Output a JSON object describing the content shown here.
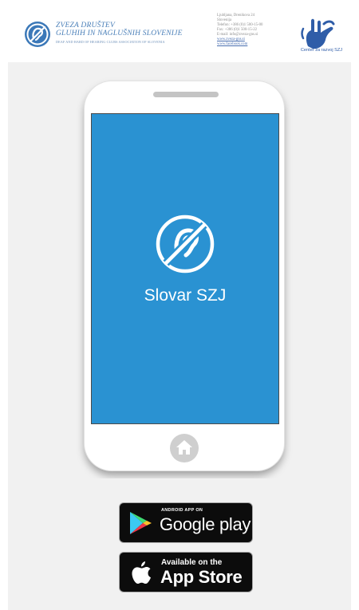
{
  "header": {
    "org": {
      "line1": "ZVEZA DRUŠTEV",
      "line2": "GLUHIH IN NAGLUŠNIH SLOVENIJE",
      "line3": "DEAF AND HARD OF HEARING CLUBS ASSOCIATION OF SLOVENIA"
    },
    "contact": {
      "address1": "Ljubljana, Drenikova 24",
      "address2": "Slovenija",
      "phone": "Telefon: +386 (0)1 500-15-00",
      "fax": "Fax: +386 (0)1 500-15-22",
      "email": "E-mail: info@zveza-gns.si",
      "web1": "www.zveza-gns.si",
      "web2": "www.facebook.com"
    },
    "center_label": "Center za razvoj SZJ"
  },
  "app": {
    "title": "Slovar SZJ"
  },
  "stores": {
    "google": {
      "small": "ANDROID APP ON",
      "large": "Google play"
    },
    "apple": {
      "small": "Available on the",
      "large": "App Store"
    }
  },
  "colors": {
    "screen": "#2a92d2",
    "org_text": "#4a7fb8",
    "center_text": "#2f5da8",
    "panel": "#f1f1f1"
  }
}
